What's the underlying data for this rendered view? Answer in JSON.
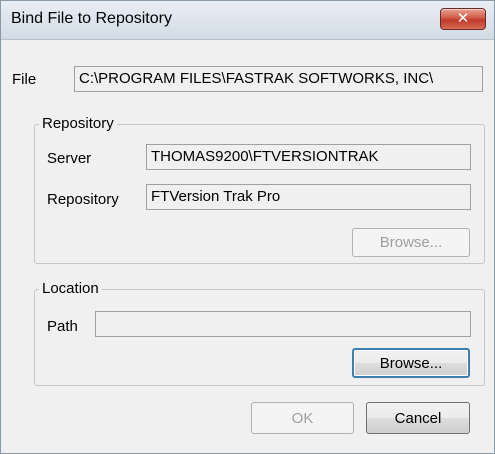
{
  "window": {
    "title": "Bind File to Repository"
  },
  "file": {
    "label": "File",
    "value": "C:\\PROGRAM FILES\\FASTRAK SOFTWORKS, INC\\"
  },
  "repository_group": {
    "title": "Repository",
    "server_label": "Server",
    "server_value": "THOMAS9200\\FTVERSIONTRAK",
    "repository_label": "Repository",
    "repository_value": "FTVersion Trak Pro",
    "browse_label": "Browse..."
  },
  "location_group": {
    "title": "Location",
    "path_label": "Path",
    "path_value": "",
    "browse_label": "Browse..."
  },
  "buttons": {
    "ok_label": "OK",
    "cancel_label": "Cancel"
  }
}
